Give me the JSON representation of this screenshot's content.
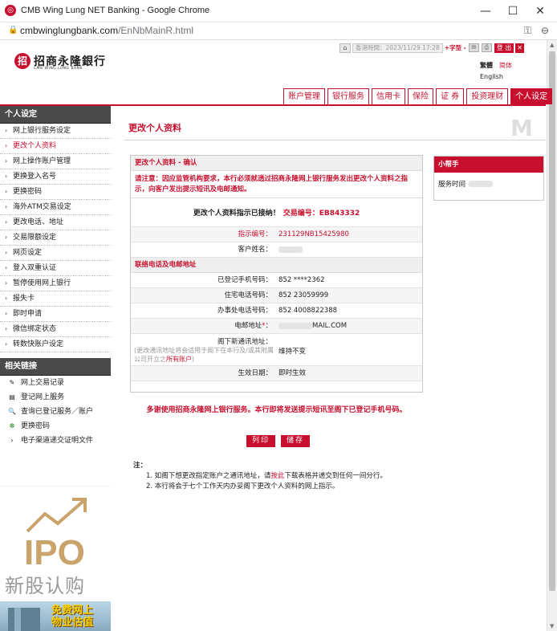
{
  "browser": {
    "title": "CMB Wing Lung NET Banking - Google Chrome",
    "url_host": "cmbwinglungbank.com",
    "url_path": "/EnNbMainR.html",
    "minimize": "—",
    "maximize": "☐",
    "close": "✕"
  },
  "header": {
    "logo_name": "招商永隆銀行",
    "logo_sub": "CMB WING LUNG BANK",
    "time_label": "香港時間：2023/11/29 17:28",
    "font_size_label": "+字型 -",
    "logout_label": "登 出",
    "lang_trad": "繁體",
    "lang_simp": "简体",
    "lang_en": "English",
    "nav": [
      "账户管理",
      "银行服务",
      "信用卡",
      "保险",
      "证 券",
      "投资理财",
      "个人设定"
    ]
  },
  "sidebar": {
    "section1_title": "个人设定",
    "items": [
      "网上银行服务设定",
      "更改个人资料",
      "网上操作账户管理",
      "更换登入名号",
      "更换密码",
      "海外ATM交易设定",
      "更改电话、地址",
      "交易限额设定",
      "网页设定",
      "登入双重认证",
      "暂停使用网上银行",
      "报失卡",
      "即时申请",
      "微信绑定状态",
      "转数快账户设定"
    ],
    "section2_title": "相关链接",
    "links": [
      {
        "label": "网上交易记录",
        "icon": "✎"
      },
      {
        "label": "登记网上服务",
        "icon": "▤"
      },
      {
        "label": "查询已登记服务／账户",
        "icon": "🔍"
      },
      {
        "label": "更换密码",
        "icon": "☸"
      },
      {
        "label": "电子渠道递交证明文件",
        "icon": "›"
      }
    ],
    "ipo_big": "IPO",
    "ipo_cn": "新股认购",
    "promo_text": "免费网上\n物业估值"
  },
  "main": {
    "page_title": "更改个人资料",
    "section1_title": "更改个人资料 - 确认",
    "notice": "请注意：因应监管机构要求，本行必须就透过招商永隆网上银行服务发出更改个人资料之指示，向客户发出提示短讯及电邮通知。",
    "confirm_text": "更改个人资料指示已接纳！",
    "confirm_ref": "交易编号：EB843332",
    "instr_label": "指示编号：",
    "instr_value": "231129NB15425980",
    "name_label": "客户姓名：",
    "section2_title": "联络电话及电邮地址",
    "mobile_label": "已登记手机号码：",
    "mobile_value": "852 ****2362",
    "home_label": "住宅电话号码：",
    "home_value": "852 23059999",
    "office_label": "办事处电话号码：",
    "office_value": "852 4008822388",
    "email_label": "电邮地址",
    "email_req": "*",
    "email_colon": "：",
    "email_value": "MAIL.COM",
    "addr_label": "阁下新通讯地址：",
    "addr_note_a": "(更改通讯地址将会适用于阁下在本行及/或其附属公司开立之",
    "addr_note_link": "所有账户",
    "addr_note_b": ")",
    "addr_value": "维持不变",
    "effective_label": "生效日期：",
    "effective_value": "即时生效",
    "thanks": "多谢使用招商永隆网上银行服务。本行即将发送提示短讯至阁下已登记手机号码。",
    "print_button": "列印",
    "save_button": "储存",
    "notes_title": "注：",
    "note1_a": "1. 如阁下想更改指定账户之通讯地址，请",
    "note1_link": "按此",
    "note1_b": "下载表格并递交到任何一间分行。",
    "note2": "2. 本行将会于七个工作天内办妥阁下更改个人资料的网上指示。"
  },
  "helper": {
    "title": "小帮手",
    "service_time": "服务时间"
  },
  "colors": {
    "brand_red": "#c8102e",
    "sidebar_head": "#4a4a4a",
    "ipo_gold": "#c9a36a"
  }
}
